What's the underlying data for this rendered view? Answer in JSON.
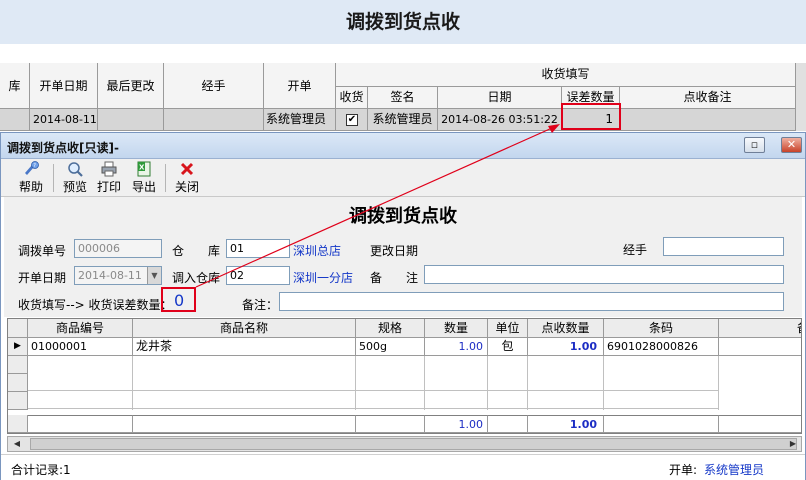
{
  "background_window": {
    "title": "调拨到货点收",
    "column_headers": {
      "col_cut": "库",
      "open_date": "开单日期",
      "last_modified": "最后更改",
      "handler": "经手",
      "opener": "开单",
      "receive_group": "收货填写",
      "received": "收货",
      "sign": "签名",
      "date": "日期",
      "error_qty": "误差数量",
      "remarks": "点收备注"
    },
    "row": {
      "open_date": "2014-08-11",
      "opener": "系统管理员",
      "received_checked": true,
      "sign": "系统管理员",
      "date": "2014-08-26 03:51:22",
      "error_qty": "1"
    }
  },
  "dialog": {
    "title": "调拨到货点收[只读]-",
    "toolbar": [
      {
        "label": "帮助",
        "icon": "help-icon"
      },
      {
        "label": "预览",
        "icon": "preview-icon"
      },
      {
        "label": "打印",
        "icon": "print-icon"
      },
      {
        "label": "导出",
        "icon": "excel-export-icon"
      },
      {
        "label": "关闭",
        "icon": "close-icon"
      }
    ],
    "form": {
      "title": "调拨到货点收",
      "transfer_no_label": "调拨单号",
      "transfer_no": "000006",
      "warehouse_label": "仓　　库",
      "warehouse_code": "01",
      "warehouse_name": "深圳总店",
      "modified_date_label": "更改日期",
      "handler_label": "经手",
      "handler_value": "",
      "open_date_label": "开单日期",
      "open_date": "2014-08-11",
      "in_warehouse_label": "调入仓库",
      "in_warehouse_code": "02",
      "in_warehouse_name": "深圳一分店",
      "remark_label": "备　　注",
      "remark_value": "",
      "receive_error_label": "收货填写--> 收货误差数量：",
      "receive_error_value": "0",
      "note_label": "备注：",
      "note_value": ""
    },
    "grid": {
      "headers": {
        "code": "商品编号",
        "name": "商品名称",
        "spec": "规格",
        "qty": "数量",
        "unit": "单位",
        "check_qty": "点收数量",
        "barcode": "条码",
        "cut": "备"
      },
      "rows": [
        {
          "indicator": "▶",
          "code": "01000001",
          "name": "龙井茶",
          "spec": "500g",
          "qty": "1.00",
          "unit": "包",
          "check_qty": "1.00",
          "barcode": "6901028000826"
        }
      ],
      "totals": {
        "qty": "1.00",
        "check_qty": "1.00"
      }
    },
    "status": {
      "records": "合计记录:1",
      "opener_label": "开单:",
      "opener": "系统管理员"
    }
  }
}
